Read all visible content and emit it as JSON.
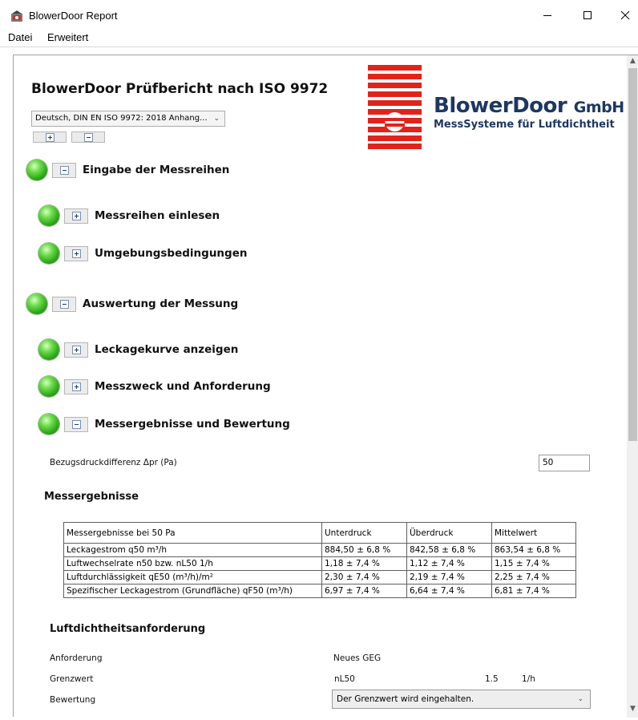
{
  "window": {
    "title": "BlowerDoor Report"
  },
  "menu": {
    "items": [
      "Datei",
      "Erweitert"
    ]
  },
  "report": {
    "title": "BlowerDoor Prüfbericht nach ISO 9972",
    "language_select": "Deutsch, DIN EN ISO 9972: 2018 Anhang..."
  },
  "logo": {
    "name": "BlowerDoor",
    "gmbh": "GmbH",
    "tagline": "MessSysteme für Luftdichtheit",
    "brand_color": "#1e3761",
    "mark_color": "#e2231a"
  },
  "sections": [
    {
      "label": "Eingabe der Messreihen",
      "expanded": true,
      "status": "green"
    },
    {
      "label": "Messreihen einlesen",
      "expanded": false,
      "status": "green"
    },
    {
      "label": "Umgebungsbedingungen",
      "expanded": false,
      "status": "green"
    },
    {
      "label": "Auswertung der Messung",
      "expanded": true,
      "status": "green"
    },
    {
      "label": "Leckagekurve anzeigen",
      "expanded": false,
      "status": "green"
    },
    {
      "label": "Messzweck und Anforderung",
      "expanded": false,
      "status": "green"
    },
    {
      "label": "Messergebnisse und Bewertung",
      "expanded": true,
      "status": "green"
    }
  ],
  "reference_pressure": {
    "label": "Bezugsdruckdifferenz Δpr (Pa)",
    "value": "50"
  },
  "results": {
    "heading": "Messergebnisse",
    "columns": [
      "Messergebnisse bei 50 Pa",
      "Unterdruck",
      "Überdruck",
      "Mittelwert"
    ],
    "rows": [
      [
        "Leckagestrom q50 m³/h",
        "884,50 ± 6,8 %",
        "842,58 ± 6,8 %",
        "863,54 ± 6,8 %"
      ],
      [
        "Luftwechselrate n50 bzw. nL50 1/h",
        "1,18 ± 7,4 %",
        "1,12 ± 7,4 %",
        "1,15 ± 7,4 %"
      ],
      [
        "Luftdurchlässigkeit qE50 (m³/h)/m²",
        "2,30 ± 7,4 %",
        "2,19 ± 7,4 %",
        "2,25 ± 7,4 %"
      ],
      [
        "Spezifischer Leckagestrom (Grundfläche) qF50 (m³/h)",
        "6,97 ± 7,4 %",
        "6,64 ± 7,4 %",
        "6,81 ± 7,4 %"
      ]
    ]
  },
  "requirement": {
    "heading": "Luftdichtheitsanforderung",
    "anforderung_label": "Anforderung",
    "anforderung_value": "Neues GEG",
    "grenzwert_label": "Grenzwert",
    "grenzwert_symbol": "nL50",
    "grenzwert_value": "1.5",
    "grenzwert_unit": "1/h",
    "bewertung_label": "Bewertung",
    "bewertung_value": "Der Grenzwert wird eingehalten."
  }
}
